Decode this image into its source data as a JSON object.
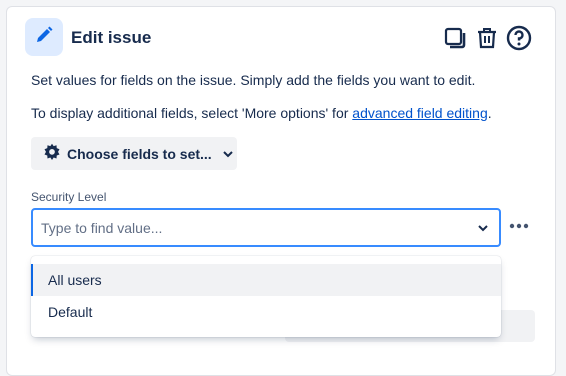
{
  "header": {
    "title": "Edit issue",
    "icon": "pencil-icon",
    "actions": [
      {
        "name": "copy-icon",
        "label": "Copy"
      },
      {
        "name": "trash-icon",
        "label": "Delete"
      },
      {
        "name": "help-icon",
        "label": "Help"
      }
    ]
  },
  "description": {
    "line1": "Set values for fields on the issue. Simply add the fields you want to edit.",
    "line2_prefix": "To display additional fields, select 'More options' for ",
    "line2_link": "advanced field editing",
    "line2_suffix": "."
  },
  "choose_fields": {
    "label": "Choose fields to set...",
    "icon": "gear-icon"
  },
  "security_level": {
    "label": "Security Level",
    "placeholder": "Type to find value...",
    "value": "",
    "options": [
      {
        "label": "All users",
        "selected": true
      },
      {
        "label": "Default",
        "selected": false
      }
    ]
  },
  "colors": {
    "accent": "#0c66e4",
    "focus_border": "#388bff",
    "text": "#172b4d",
    "icon_bg": "#deebff",
    "link": "#0052cc"
  }
}
